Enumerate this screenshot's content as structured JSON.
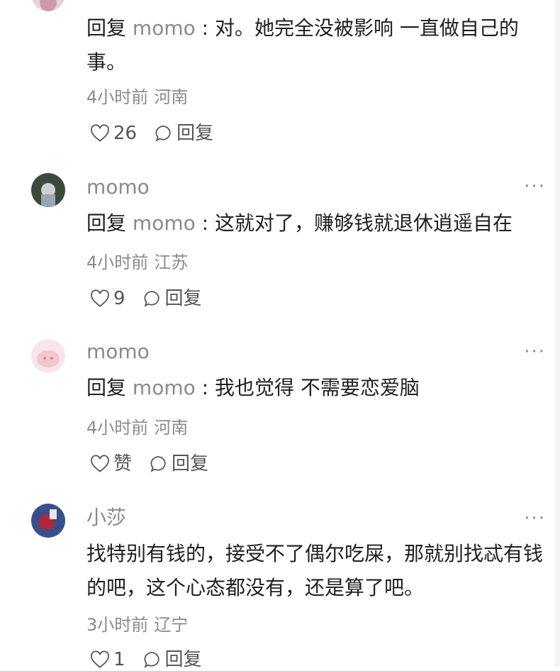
{
  "comments": [
    {
      "username": "",
      "reply_prefix": "回复",
      "reply_target": "momo",
      "separator": " : ",
      "text": "对。她完全没被影响 一直做自己的事。",
      "time": "4小时前",
      "location": "河南",
      "likes": "26",
      "reply_label": "回复"
    },
    {
      "username": "momo",
      "more": "···",
      "reply_prefix": "回复",
      "reply_target": "momo",
      "separator": " : ",
      "text": "这就对了，赚够钱就退休逍遥自在",
      "time": "4小时前",
      "location": "江苏",
      "likes": "9",
      "reply_label": "回复"
    },
    {
      "username": "momo",
      "more": "···",
      "reply_prefix": "回复",
      "reply_target": "momo",
      "separator": " : ",
      "text": "我也觉得 不需要恋爱脑",
      "time": "4小时前",
      "location": "河南",
      "likes": "赞",
      "reply_label": "回复"
    },
    {
      "username": "小莎",
      "more": "···",
      "text": "找特别有钱的，接受不了偶尔吃屎，那就别找忒有钱的吧，这个心态都没有，还是算了吧。",
      "time": "3小时前",
      "location": "辽宁",
      "likes": "1",
      "reply_label": "回复"
    }
  ],
  "icons": {
    "like": "heart-outline-icon",
    "reply": "speech-bubble-icon",
    "more": "ellipsis-icon"
  },
  "colors": {
    "primary_text": "#1f1f1f",
    "secondary_text": "#8a8a8a",
    "icon": "#555555"
  }
}
